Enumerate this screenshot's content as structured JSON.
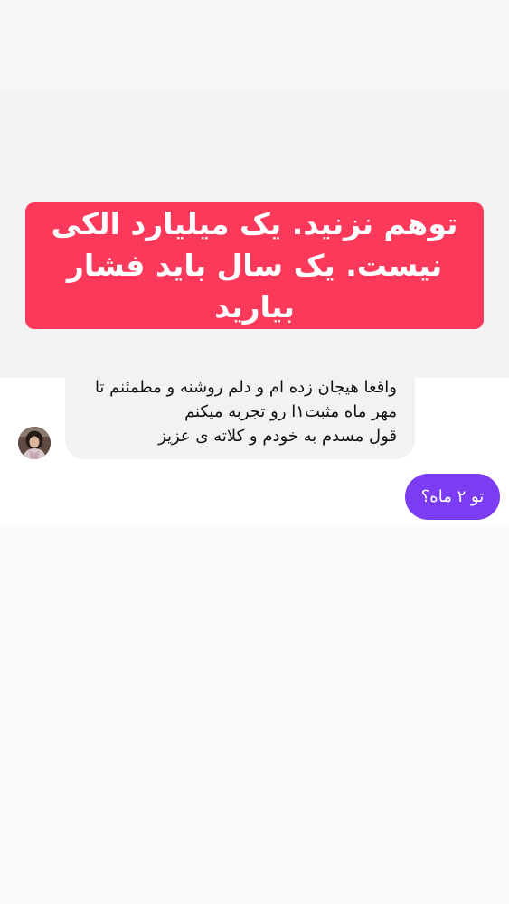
{
  "banner": {
    "text": "توهم نزنید. یک میلیارد الکی\nنیست. یک سال باید فشار بیارید",
    "color": "#fb3a5b"
  },
  "chat": {
    "incoming_message": "واقعا هیجان زده ام و دلم روشنه و مطمئنم تا\nمهر ماه مثبت١ا رو تجربه میکنم\nقول مسدم به خودم و کلاته ی عزیز",
    "outgoing_message": "تو ۲ ماه؟",
    "outgoing_color": "#7b3cf2"
  },
  "avatar": {
    "icon": "profile-photo"
  }
}
